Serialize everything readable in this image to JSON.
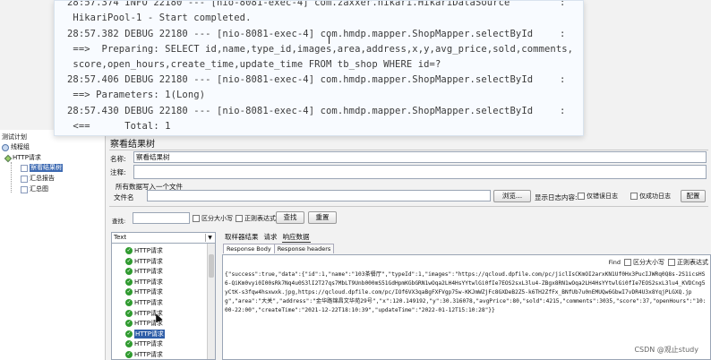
{
  "console": {
    "lines": [
      {
        "ts": "28:57.374",
        "level": "INFO",
        "pid": "22180",
        "sep": "---",
        "thread": "[nio-8081-exec-4]",
        "logger": "com.zaxxer.hikari.HikariDataSource",
        "colon": ":"
      },
      {
        "msg": " HikariPool-1 - Start completed."
      },
      {
        "ts": "28:57.382",
        "level": "DEBUG",
        "pid": "22180",
        "sep": "---",
        "thread": "[nio-8081-exec-4]",
        "logger": "com.hmdp.mapper.ShopMapper.selectById",
        "colon": ":"
      },
      {
        "msg": " ==>  Preparing: SELECT id,name,type_id,images,area,address,x,y,avg_price,sold,comments,"
      },
      {
        "msg": " score,open_hours,create_time,update_time FROM tb_shop WHERE id=?"
      },
      {
        "ts": "28:57.406",
        "level": "DEBUG",
        "pid": "22180",
        "sep": "---",
        "thread": "[nio-8081-exec-4]",
        "logger": "com.hmdp.mapper.ShopMapper.selectById",
        "colon": ":"
      },
      {
        "msg": " ==> Parameters: 1(Long)"
      },
      {
        "ts": "28:57.430",
        "level": "DEBUG",
        "pid": "22180",
        "sep": "---",
        "thread": "[nio-8081-exec-4]",
        "logger": "com.hmdp.mapper.ShopMapper.selectById",
        "colon": ":"
      },
      {
        "msg": " <==      Total: 1"
      }
    ]
  },
  "tree": {
    "root": "测试计划",
    "thread_group": "线程组",
    "http_request": "HTTP请求",
    "view_results": "察看结果树",
    "summary_report": "汇总报告",
    "summary_graph": "汇总图"
  },
  "panel": {
    "title": "察看结果树",
    "name_label": "名称:",
    "name_value": "察看结果树",
    "comment_label": "注释:",
    "comment_value": "",
    "file_section": "所有数据写入一个文件",
    "file_label": "文件名",
    "file_value": "",
    "browse_button": "浏览...",
    "log_label": "显示日志内容:",
    "errors_only": "仅错误日志",
    "success_only": "仅成功日志",
    "configure_button": "配置",
    "search_label": "查找:",
    "search_value": "",
    "case_sensitive": "区分大小写",
    "regex": "正则表达式",
    "search_button": "查找",
    "reset_button": "重置"
  },
  "results": {
    "renderer": "Text",
    "items": [
      "HTTP请求",
      "HTTP请求",
      "HTTP请求",
      "HTTP请求",
      "HTTP请求",
      "HTTP请求",
      "HTTP请求",
      "HTTP请求",
      "HTTP请求",
      "HTTP请求",
      "HTTP请求",
      "HTTP请求"
    ],
    "selected_index": 8,
    "tabs": [
      "取样器结果",
      "请求",
      "响应数据"
    ],
    "active_tab": "响应数据",
    "subtabs": [
      "Response Body",
      "Response headers"
    ],
    "active_subtab": "Response Body",
    "find_label": "Find",
    "find_case": "区分大小写",
    "find_regex": "正则表达式",
    "response_body": "{\"success\":true,\"data\":{\"id\":1,\"name\":\"103茶餐厅\",\"typeId\":1,\"images\":\"https://qcloud.dpfile.com/pc/jiclIsCKmOI2arxKN1Uf0Hx3PucIJWRq0Q8s-2S1icsHS6-QiKm0vyi0I00sRk7Nq4u0S3lI2T27qs7MbLT9Unb000mS51GdHpmKGbGRN1wOqa2LH4HsYYtwlGi0fIe7EOS2sxL3lu4-ZBgx8RN1wOqa2LH4HsYYtwlGi0fIe7EOS2sxL3lu4_KVDCng5yCtK-s3fqw4hsxwxk.jpg,https://qcloud.dpfile.com/pc/IOf6VX3qaBgFXFVgp75w-KKJmWZjFc8GXDeB2Z5-k6TH2ZfFx_BNfUb7u0nEMUQw6GbwI7vDR4U3x8YqjPLGXQ.jpg\",\"area\":\"大关\",\"address\":\"金华路锦昌文华苑29号\",\"x\":120.149192,\"y\":30.316078,\"avgPrice\":80,\"sold\":4215,\"comments\":3035,\"score\":37,\"openHours\":\"10:00-22:00\",\"createTime\":\"2021-12-22T18:10:39\",\"updateTime\":\"2022-01-12T15:10:28\"}}"
  },
  "watermark": "CSDN @观止study"
}
